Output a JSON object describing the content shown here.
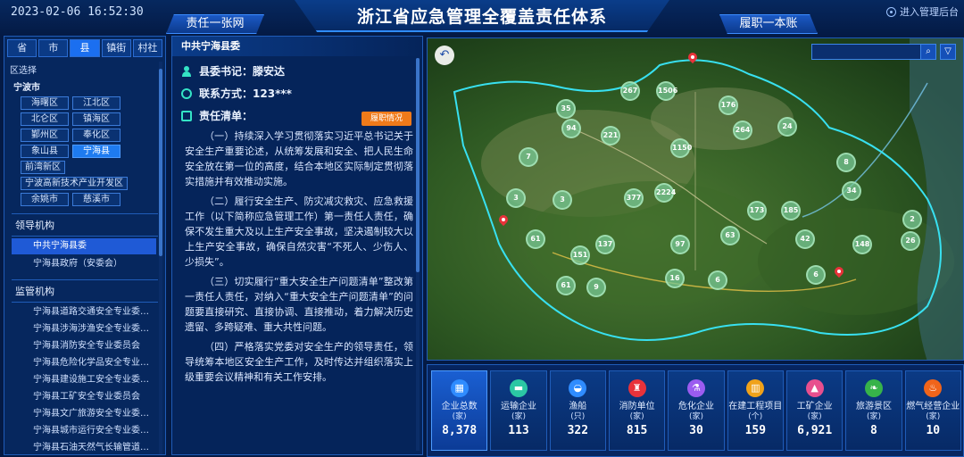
{
  "header": {
    "datetime": "2023-02-06 16:52:30",
    "title": "浙江省应急管理全覆盖责任体系",
    "left_tab": "责任一张网",
    "right_tab": "履职一本账",
    "login_link": "进入管理后台"
  },
  "left_panel": {
    "level_tabs": [
      "省",
      "市",
      "县",
      "镇街",
      "村社"
    ],
    "active_level": "县",
    "region_label": "区选择",
    "city": "宁波市",
    "districts": [
      "海曙区",
      "江北区",
      "北仑区",
      "镇海区",
      "鄞州区",
      "奉化区",
      "象山县",
      "宁海县",
      "前湾新区",
      "宁波高新技术产业开发区",
      "余姚市",
      "慈溪市"
    ],
    "active_district": "宁海县",
    "leadership_title": "领导机构",
    "leadership_items": [
      "中共宁海县委",
      "宁海县政府（安委会）"
    ],
    "supervision_title": "监管机构",
    "supervision_items": [
      "宁海县道路交通安全专业委…",
      "宁海县涉海涉渔安全专业委…",
      "宁海县消防安全专业委员会",
      "宁海县危险化学品安全专业…",
      "宁海县建设施工安全专业委…",
      "宁海县工矿安全专业委员会",
      "宁海县文广旅游安全专业委…",
      "宁海县城市运行安全专业委…",
      "宁海县石油天然气长输管道…"
    ]
  },
  "mid_panel": {
    "org_name": "中共宁海县委",
    "secretary_label": "县委书记：",
    "secretary_name": "滕安达",
    "contact_label": "联系方式：",
    "contact_value": "123***",
    "duty_label": "责任清单：",
    "duty_button": "履职情况",
    "paragraphs": [
      "（一）持续深入学习贯彻落实习近平总书记关于安全生产重要论述，从统筹发展和安全、把人民生命安全放在第一位的高度，结合本地区实际制定贯彻落实措施并有效推动实施。",
      "（二）履行安全生产、防灾减灾救灾、应急救援工作（以下简称应急管理工作）第一责任人责任，确保不发生重大及以上生产安全事故，坚决遏制较大以上生产安全事故，确保自然灾害“不死人、少伤人、少损失”。",
      "（三）切实履行“重大安全生产问题清单”整改第一责任人责任，对纳入“重大安全生产问题清单”的问题要直接研究、直接协调、直接推动，着力解决历史遗留、多跨疑难、重大共性问题。",
      "（四）严格落实党委对安全生产的领导责任，领导统筹本地区安全生产工作，及时传达并组织落实上级重要会议精神和有关工作安排。"
    ]
  },
  "map": {
    "clusters": [
      "267",
      "1506",
      "35",
      "94",
      "221",
      "176",
      "264",
      "24",
      "7",
      "1150",
      "8",
      "34",
      "3",
      "3",
      "377",
      "2224",
      "173",
      "185",
      "2",
      "61",
      "137",
      "97",
      "63",
      "42",
      "148",
      "26",
      "151",
      "16",
      "6",
      "6",
      "61",
      "9"
    ]
  },
  "stats": [
    {
      "label": "企业总数",
      "unit": "(家)",
      "value": "8,378",
      "icon": "building-icon",
      "color": "#2f8cff"
    },
    {
      "label": "运输企业",
      "unit": "(家)",
      "value": "113",
      "icon": "truck-icon",
      "color": "#2bc7a4"
    },
    {
      "label": "渔船",
      "unit": "(只)",
      "value": "322",
      "icon": "ship-icon",
      "color": "#2f8cff"
    },
    {
      "label": "消防单位",
      "unit": "(家)",
      "value": "815",
      "icon": "fire-hydrant-icon",
      "color": "#e8323a"
    },
    {
      "label": "危化企业",
      "unit": "(家)",
      "value": "30",
      "icon": "flask-icon",
      "color": "#9b5cf0"
    },
    {
      "label": "在建工程项目",
      "unit": "(个)",
      "value": "159",
      "icon": "construction-icon",
      "color": "#f0a21a"
    },
    {
      "label": "工矿企业",
      "unit": "(家)",
      "value": "6,921",
      "icon": "mine-icon",
      "color": "#e84f8e"
    },
    {
      "label": "旅游景区",
      "unit": "(家)",
      "value": "8",
      "icon": "leaf-icon",
      "color": "#37b34a"
    },
    {
      "label": "燃气经营企业",
      "unit": "(家)",
      "value": "10",
      "icon": "flame-icon",
      "color": "#f0641a"
    }
  ],
  "active_stat": "企业总数"
}
